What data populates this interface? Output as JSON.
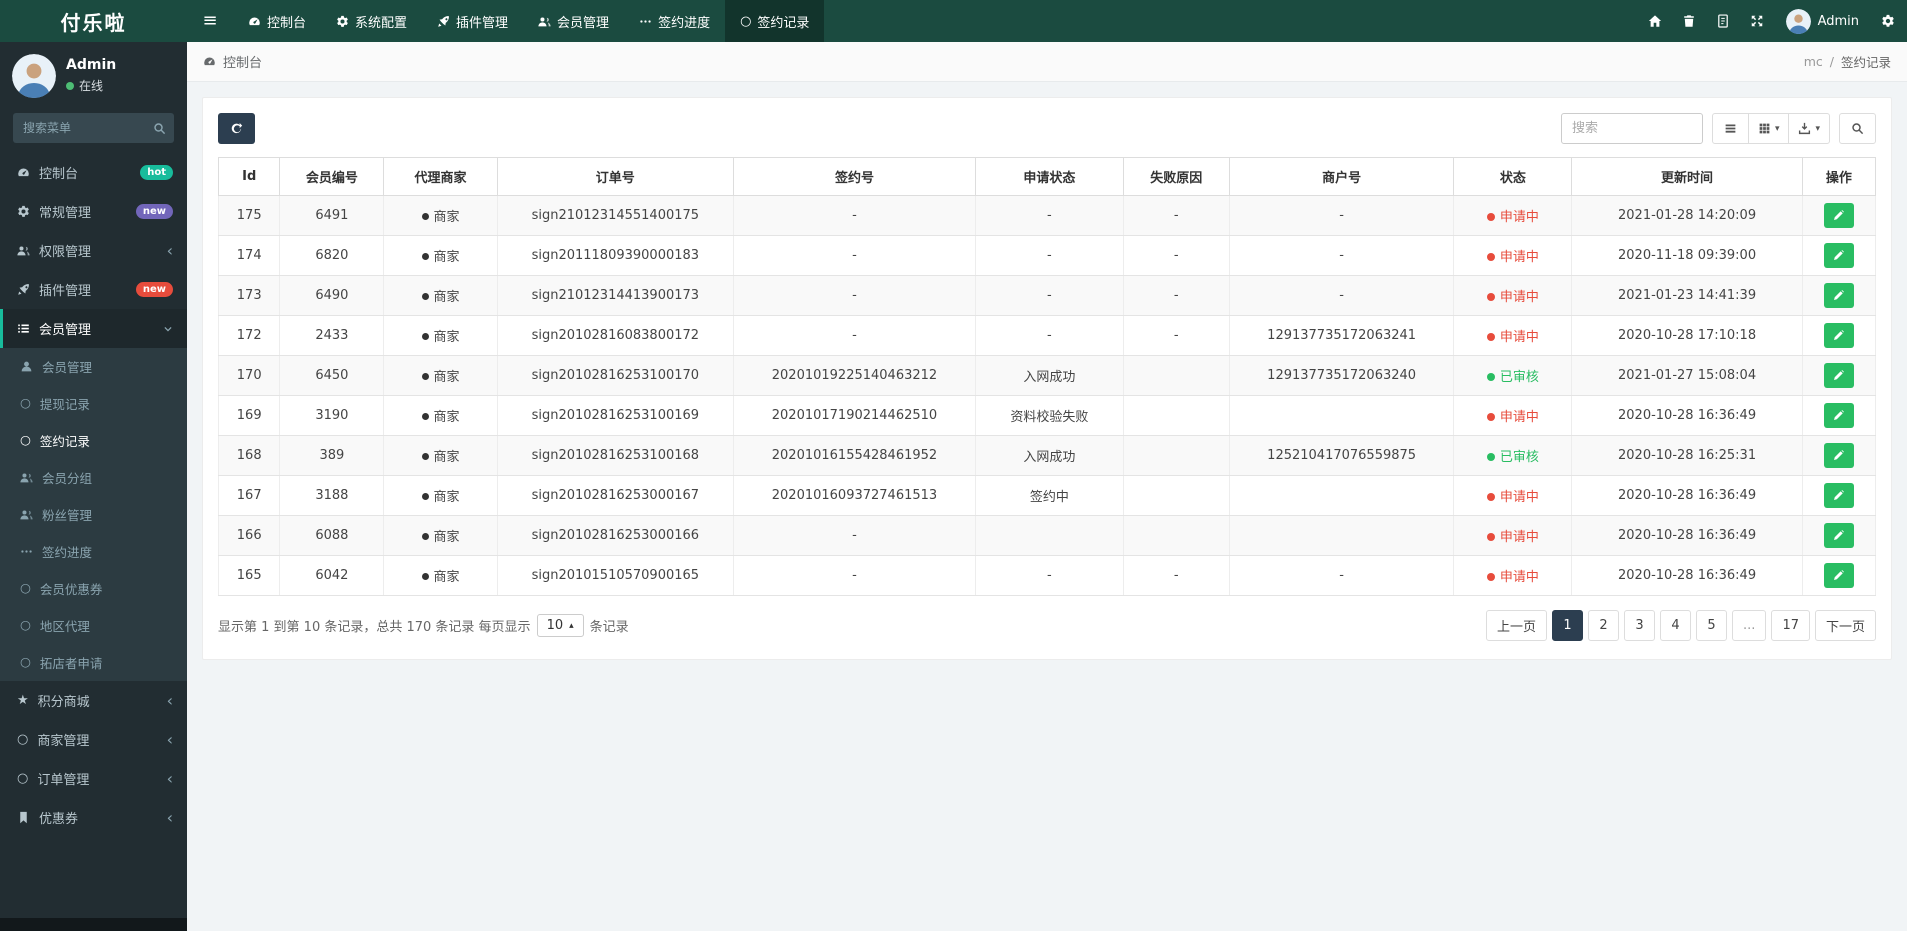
{
  "brand": {
    "name": "付乐啦"
  },
  "colors": {
    "navbar": "#1b4b40",
    "sidebar": "#222d32",
    "accent_teal": "#18bc9c",
    "badge_hot": "#18bc9c",
    "badge_new_purple": "#7266ba",
    "badge_new_red": "#e74c3c",
    "status_pending": "#e74c3c",
    "status_approved": "#29bd62",
    "pagination_active": "#2c3e50"
  },
  "topnav": {
    "items": [
      {
        "label": "控制台",
        "icon": "dashboard",
        "active": false
      },
      {
        "label": "系统配置",
        "icon": "gear",
        "active": false
      },
      {
        "label": "插件管理",
        "icon": "rocket",
        "active": false
      },
      {
        "label": "会员管理",
        "icon": "users",
        "active": false
      },
      {
        "label": "签约进度",
        "icon": "ellipsis",
        "active": false
      },
      {
        "label": "签约记录",
        "icon": "circle",
        "active": true
      }
    ],
    "right_icons": [
      "home",
      "trash",
      "file",
      "expand"
    ],
    "user": {
      "name": "Admin"
    },
    "trailing_icon": "gear"
  },
  "sidebar": {
    "user": {
      "name": "Admin",
      "status_label": "在线"
    },
    "search_placeholder": "搜索菜单",
    "menu": [
      {
        "label": "控制台",
        "icon": "dashboard",
        "badge": {
          "text": "hot",
          "color": "#18bc9c"
        }
      },
      {
        "label": "常规管理",
        "icon": "gears",
        "badge": {
          "text": "new",
          "color": "#7266ba"
        }
      },
      {
        "label": "权限管理",
        "icon": "users",
        "arrow": "left"
      },
      {
        "label": "插件管理",
        "icon": "rocket",
        "badge": {
          "text": "new",
          "color": "#e74c3c"
        }
      },
      {
        "label": "会员管理",
        "icon": "list",
        "arrow": "down",
        "active": true,
        "children": [
          {
            "label": "会员管理",
            "icon": "user"
          },
          {
            "label": "提现记录",
            "icon": "circle"
          },
          {
            "label": "签约记录",
            "icon": "circle",
            "active": true
          },
          {
            "label": "会员分组",
            "icon": "users"
          },
          {
            "label": "粉丝管理",
            "icon": "users"
          },
          {
            "label": "签约进度",
            "icon": "ellipsis"
          },
          {
            "label": "会员优惠券",
            "icon": "circle"
          },
          {
            "label": "地区代理",
            "icon": "circle"
          },
          {
            "label": "拓店者申请",
            "icon": "circle"
          }
        ]
      },
      {
        "label": "积分商城",
        "icon": "star",
        "arrow": "left"
      },
      {
        "label": "商家管理",
        "icon": "circle",
        "arrow": "left"
      },
      {
        "label": "订单管理",
        "icon": "circle",
        "arrow": "left"
      },
      {
        "label": "优惠券",
        "icon": "bookmark",
        "arrow": "left"
      }
    ]
  },
  "breadcrumb": {
    "left": "控制台",
    "right": [
      "mc",
      "签约记录"
    ],
    "separator": "/"
  },
  "toolbar": {
    "search_placeholder": "搜索",
    "buttons": [
      {
        "name": "toggle-view",
        "icon": "rows",
        "caret": false
      },
      {
        "name": "columns",
        "icon": "grid",
        "caret": true
      },
      {
        "name": "export",
        "icon": "export",
        "caret": true
      }
    ]
  },
  "table": {
    "columns": [
      "Id",
      "会员编号",
      "代理商家",
      "订单号",
      "签约号",
      "申请状态",
      "失败原因",
      "商户号",
      "状态",
      "更新时间",
      "操作"
    ],
    "rows": [
      {
        "id": "175",
        "member_no": "6491",
        "agent": "商家",
        "order_no": "sign21012314551400175",
        "sign_no": "-",
        "apply_status": "-",
        "fail_reason": "-",
        "merchant_no": "-",
        "status": {
          "label": "申请中",
          "type": "pending"
        },
        "updated": "2021-01-28 14:20:09"
      },
      {
        "id": "174",
        "member_no": "6820",
        "agent": "商家",
        "order_no": "sign20111809390000183",
        "sign_no": "-",
        "apply_status": "-",
        "fail_reason": "-",
        "merchant_no": "-",
        "status": {
          "label": "申请中",
          "type": "pending"
        },
        "updated": "2020-11-18 09:39:00"
      },
      {
        "id": "173",
        "member_no": "6490",
        "agent": "商家",
        "order_no": "sign21012314413900173",
        "sign_no": "-",
        "apply_status": "-",
        "fail_reason": "-",
        "merchant_no": "-",
        "status": {
          "label": "申请中",
          "type": "pending"
        },
        "updated": "2021-01-23 14:41:39"
      },
      {
        "id": "172",
        "member_no": "2433",
        "agent": "商家",
        "order_no": "sign20102816083800172",
        "sign_no": "-",
        "apply_status": "-",
        "fail_reason": "-",
        "merchant_no": "129137735172063241",
        "status": {
          "label": "申请中",
          "type": "pending"
        },
        "updated": "2020-10-28 17:10:18"
      },
      {
        "id": "170",
        "member_no": "6450",
        "agent": "商家",
        "order_no": "sign20102816253100170",
        "sign_no": "20201019225140463212",
        "apply_status": "入网成功",
        "fail_reason": "",
        "merchant_no": "129137735172063240",
        "status": {
          "label": "已审核",
          "type": "approved"
        },
        "updated": "2021-01-27 15:08:04"
      },
      {
        "id": "169",
        "member_no": "3190",
        "agent": "商家",
        "order_no": "sign20102816253100169",
        "sign_no": "20201017190214462510",
        "apply_status": "资料校验失败",
        "fail_reason": "",
        "merchant_no": "",
        "status": {
          "label": "申请中",
          "type": "pending"
        },
        "updated": "2020-10-28 16:36:49"
      },
      {
        "id": "168",
        "member_no": "389",
        "agent": "商家",
        "order_no": "sign20102816253100168",
        "sign_no": "20201016155428461952",
        "apply_status": "入网成功",
        "fail_reason": "",
        "merchant_no": "125210417076559875",
        "status": {
          "label": "已审核",
          "type": "approved"
        },
        "updated": "2020-10-28 16:25:31"
      },
      {
        "id": "167",
        "member_no": "3188",
        "agent": "商家",
        "order_no": "sign20102816253000167",
        "sign_no": "20201016093727461513",
        "apply_status": "签约中",
        "fail_reason": "",
        "merchant_no": "",
        "status": {
          "label": "申请中",
          "type": "pending"
        },
        "updated": "2020-10-28 16:36:49"
      },
      {
        "id": "166",
        "member_no": "6088",
        "agent": "商家",
        "order_no": "sign20102816253000166",
        "sign_no": "-",
        "apply_status": "",
        "fail_reason": "",
        "merchant_no": "",
        "status": {
          "label": "申请中",
          "type": "pending"
        },
        "updated": "2020-10-28 16:36:49"
      },
      {
        "id": "165",
        "member_no": "6042",
        "agent": "商家",
        "order_no": "sign20101510570900165",
        "sign_no": "-",
        "apply_status": "-",
        "fail_reason": "-",
        "merchant_no": "-",
        "status": {
          "label": "申请中",
          "type": "pending"
        },
        "updated": "2020-10-28 16:36:49"
      }
    ]
  },
  "footer": {
    "summary": {
      "prefix": "显示第 1 到第 10 条记录，总共 170 条记录 每页显示",
      "page_size": "10",
      "suffix": "条记录"
    },
    "pagination": [
      {
        "label": "上一页",
        "type": "nav"
      },
      {
        "label": "1",
        "active": true
      },
      {
        "label": "2"
      },
      {
        "label": "3"
      },
      {
        "label": "4"
      },
      {
        "label": "5"
      },
      {
        "label": "...",
        "type": "ellipsis"
      },
      {
        "label": "17"
      },
      {
        "label": "下一页",
        "type": "nav"
      }
    ]
  }
}
